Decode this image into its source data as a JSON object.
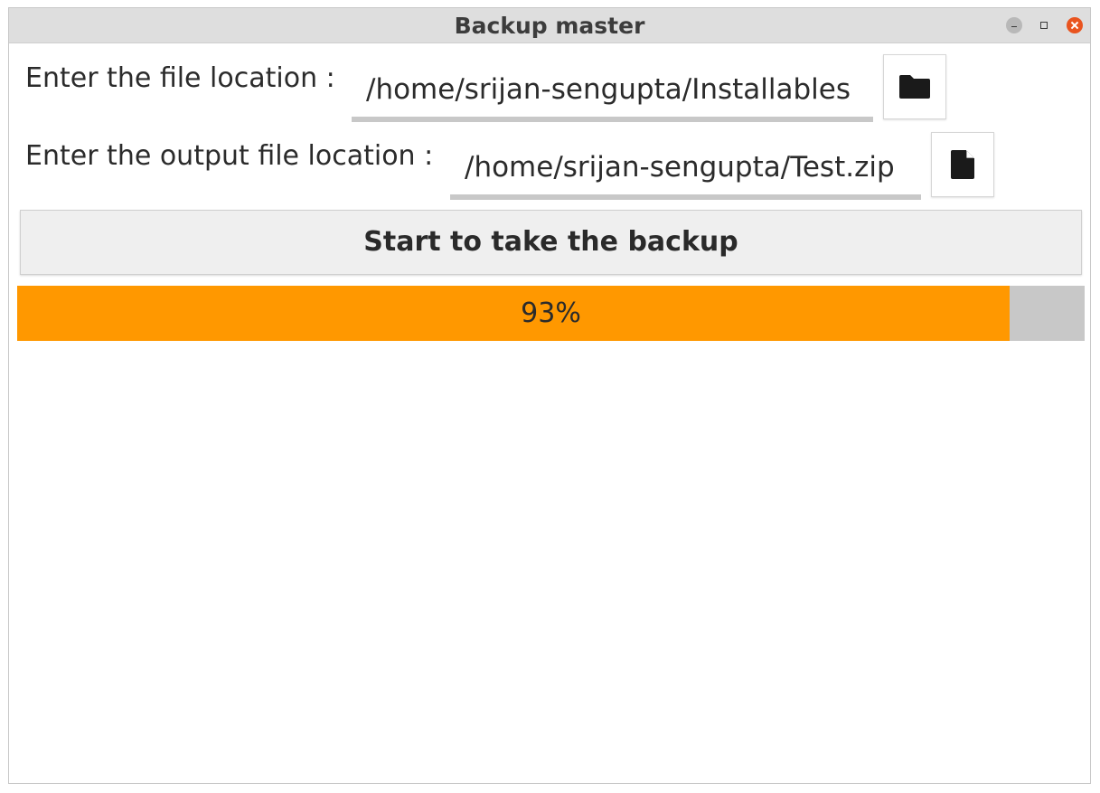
{
  "window": {
    "title": "Backup master"
  },
  "form": {
    "source": {
      "label": "Enter the file location :",
      "value": "/home/srijan-sengupta/Installables",
      "browse_icon": "folder-icon"
    },
    "output": {
      "label": "Enter the output file location :",
      "value": "/home/srijan-sengupta/Test.zip",
      "browse_icon": "file-icon"
    }
  },
  "actions": {
    "start_label": "Start to take the backup"
  },
  "progress": {
    "percent": 93,
    "label": "93%",
    "fill_color": "#ff9800",
    "track_color": "#c8c8c8"
  }
}
